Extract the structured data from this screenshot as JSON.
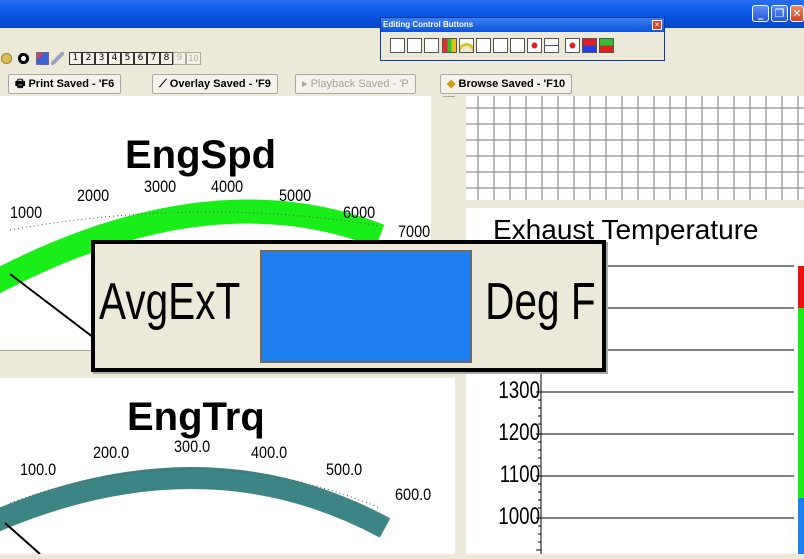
{
  "window": {
    "minimize_label": "_",
    "restore_label": "❐",
    "close_label": "✕"
  },
  "page_buttons": [
    "1",
    "2",
    "3",
    "4",
    "5",
    "6",
    "7",
    "8",
    "9",
    "10"
  ],
  "toolbar2": {
    "print_saved": "Print Saved - 'F6",
    "overlay_saved": "Overlay Saved - 'F9",
    "playback_saved": "Playback Saved - 'P",
    "browse_saved": "Browse Saved - 'F10"
  },
  "palette": {
    "title": "Editing Control Buttons",
    "close_label": "✕"
  },
  "gauge_engspd": {
    "title": "EngSpd",
    "labels": [
      "1000",
      "2000",
      "3000",
      "4000",
      "5000",
      "6000",
      "7000"
    ],
    "arc_color": "#19ee19"
  },
  "gauge_engtrq": {
    "title": "EngTrq",
    "labels": [
      "100.0",
      "200.0",
      "300.0",
      "400.0",
      "500.0",
      "600.0"
    ],
    "arc_color": "#3d8585"
  },
  "exhaust_chart": {
    "title": "Exhaust Temperature",
    "y_ticks": [
      "1300",
      "1200",
      "1100",
      "1000"
    ]
  },
  "overlay": {
    "label": "AvgExT",
    "unit": "Deg F",
    "value_color": "#1d7ff0"
  }
}
